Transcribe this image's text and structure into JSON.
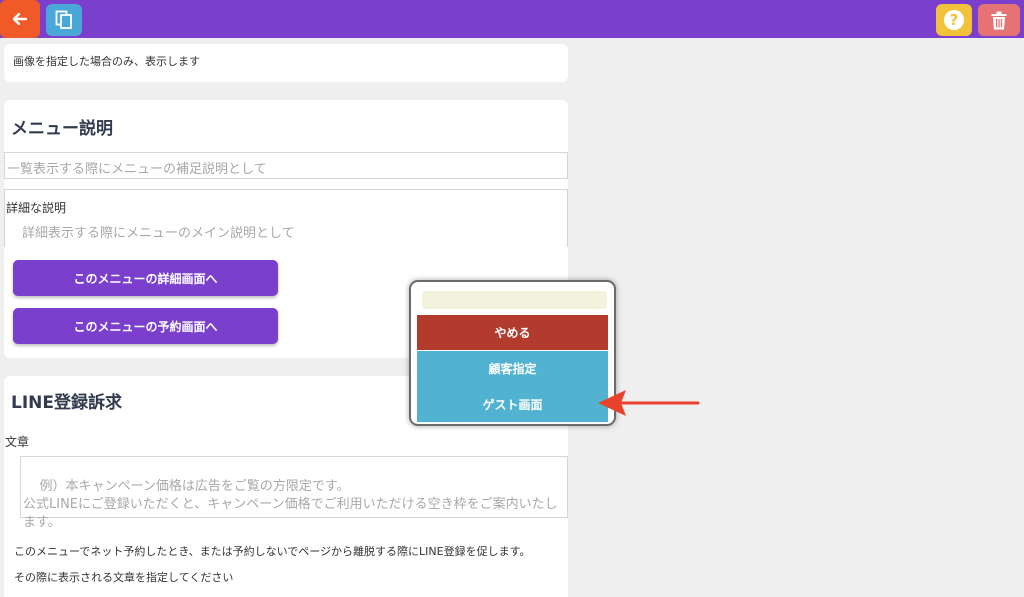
{
  "toolbar": {
    "back_icon": "arrow-left-icon",
    "copy_icon": "copy-icon",
    "help_icon": "question-icon",
    "trash_icon": "trash-icon",
    "colors": {
      "bar": "#7a3fcc",
      "back": "#f05a28",
      "copy": "#4aa8d8",
      "help": "#f2c23a",
      "trash": "#e57373"
    }
  },
  "image_section": {
    "note": "画像を指定した場合のみ、表示します"
  },
  "menu_description": {
    "heading": "メニュー説明",
    "summary_placeholder": "一覧表示する際にメニューの補足説明として",
    "detail_label": "詳細な説明",
    "detail_placeholder": "詳細表示する際にメニューのメイン説明として",
    "detail_button": "このメニューの詳細画面へ",
    "reserve_button": "このメニューの予約画面へ"
  },
  "line_section": {
    "heading": "LINE登録訴求",
    "text_label": "文章",
    "text_placeholder": "例）本キャンペーン価格は広告をご覧の方限定です。\n公式LINEにご登録いただくと、キャンペーン価格でご利用いただける空き枠をご案内いたします。",
    "note1": "このメニューでネット予約したとき、または予約しないでページから離脱する際にLINE登録を促します。",
    "note2": "その際に表示される文章を指定してください"
  },
  "popup": {
    "input_value": "",
    "cancel_label": "やめる",
    "customer_label": "顧客指定",
    "guest_label": "ゲスト画面",
    "colors": {
      "cancel": "#b23b2e",
      "option": "#51b3d1",
      "input": "#f3f2dd"
    }
  },
  "annotation": {
    "arrow_color": "#e8412c"
  }
}
